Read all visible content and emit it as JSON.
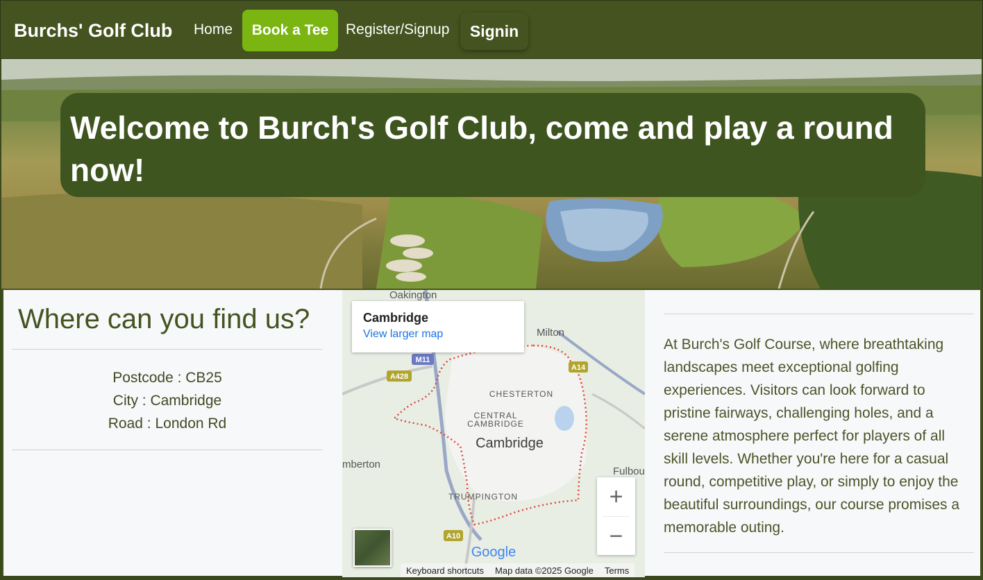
{
  "nav": {
    "brand": "Burchs' Golf Club",
    "home": "Home",
    "book": "Book a Tee",
    "register": "Register/Signup",
    "signin": "Signin"
  },
  "hero": {
    "title": "Welcome to Burch's Golf Club, come and play a round now!"
  },
  "location": {
    "title": "Where can you find us?",
    "postcode": "Postcode : CB25",
    "city": "City : Cambridge",
    "road": "Road : London Rd"
  },
  "map": {
    "card_title": "Cambridge",
    "card_link": "View larger map",
    "labels": {
      "oakington": "Oakington",
      "milton": "Milton",
      "chesterton": "CHESTERTON",
      "central1": "CENTRAL",
      "central2": "CAMBRIDGE",
      "city": "Cambridge",
      "barton": "mberton",
      "fulbourn": "Fulbou",
      "trumpington": "TRUMPINGTON",
      "m11": "M11",
      "a428": "A428",
      "a14": "A14",
      "a10": "A10",
      "google": "Google"
    },
    "footer": {
      "shortcuts": "Keyboard shortcuts",
      "data": "Map data ©2025 Google",
      "terms": "Terms"
    },
    "zoom_in": "+",
    "zoom_out": "−"
  },
  "about": {
    "text": "At Burch's Golf Course, where breathtaking landscapes meet exceptional golfing experiences. Visitors can look forward to pristine fairways, challenging holes, and a serene atmosphere perfect for players of all skill levels. Whether you're here for a casual round, competitive play, or simply to enjoy the beautiful surroundings, our course promises a memorable outing."
  },
  "colors": {
    "nav_bg": "#44531f",
    "book_button": "#7bb512",
    "banner_bg": "#3f5520",
    "link_blue": "#1a73e8"
  }
}
